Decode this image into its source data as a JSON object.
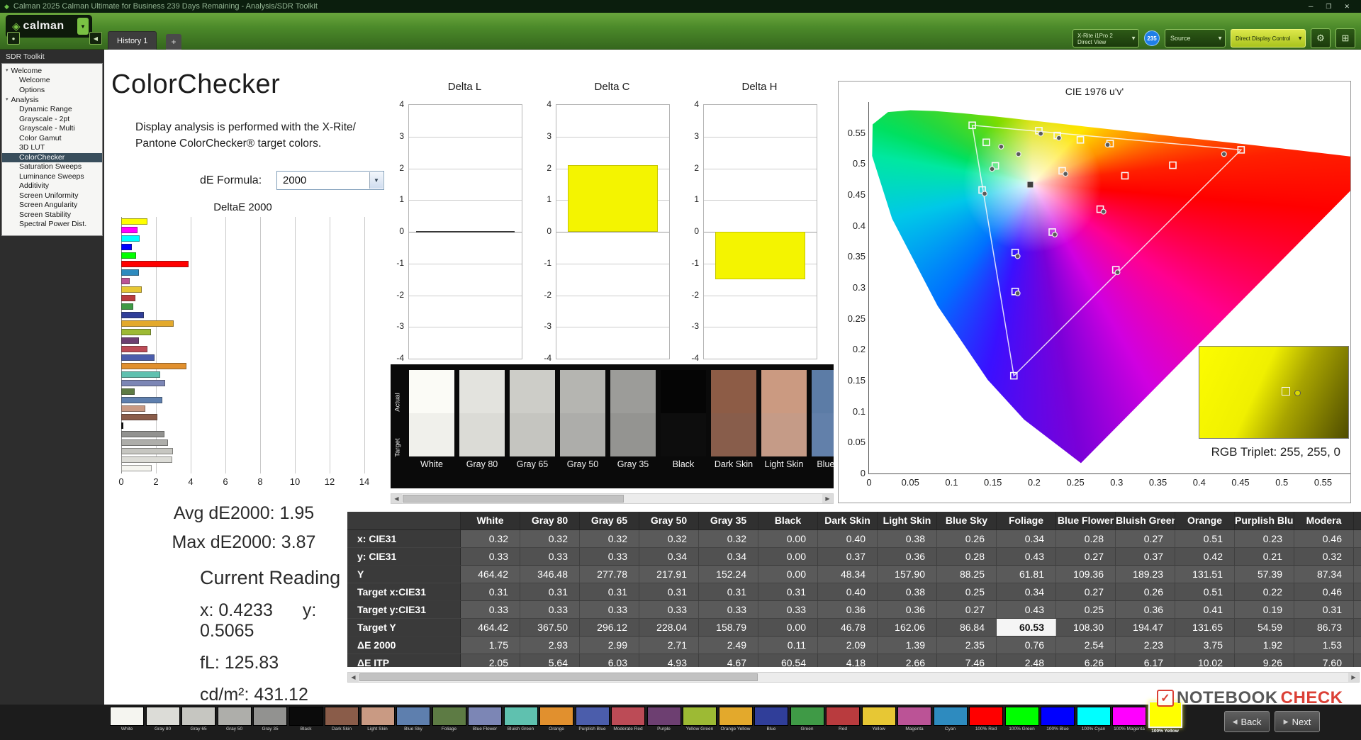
{
  "titlebar": {
    "title": "Calman 2025 Calman Ultimate for Business 239 Days Remaining  - Analysis/SDR Toolkit"
  },
  "toolbar": {
    "logo_text": "calman",
    "meter_line1": "X-Rite i1Pro 2",
    "meter_line2": "Direct View",
    "badge": "235",
    "source_label": "Source",
    "display_label": "Direct Display Control"
  },
  "tabs": {
    "history": "History 1",
    "add": "+"
  },
  "sidebar": {
    "title": "SDR Toolkit",
    "groups": [
      {
        "label": "Welcome",
        "items": [
          {
            "label": "Welcome"
          },
          {
            "label": "Options"
          }
        ]
      },
      {
        "label": "Analysis",
        "items": [
          {
            "label": "Dynamic Range"
          },
          {
            "label": "Grayscale - 2pt"
          },
          {
            "label": "Grayscale - Multi"
          },
          {
            "label": "Color Gamut"
          },
          {
            "label": "3D LUT"
          },
          {
            "label": "ColorChecker",
            "selected": true
          },
          {
            "label": "Saturation Sweeps"
          },
          {
            "label": "Luminance Sweeps"
          },
          {
            "label": "Additivity"
          },
          {
            "label": "Screen Uniformity"
          },
          {
            "label": "Screen Angularity"
          },
          {
            "label": "Screen Stability"
          },
          {
            "label": "Spectral Power Dist."
          }
        ]
      }
    ]
  },
  "page": {
    "title": "ColorChecker",
    "description_line1": "Display analysis is performed with the X-Rite/",
    "description_line2": "Pantone ColorChecker® target colors.",
    "formula_label": "dE Formula:",
    "formula_value": "2000"
  },
  "chart_data": [
    {
      "type": "bar",
      "orientation": "horizontal",
      "title": "DeltaE 2000",
      "xlim": [
        0,
        14
      ],
      "xticks": [
        0,
        2,
        4,
        6,
        8,
        10,
        12,
        14
      ],
      "categories": [
        "100% Yellow",
        "100% Magenta",
        "100% Cyan",
        "100% Blue",
        "100% Green",
        "100% Red",
        "Cyan",
        "Magenta",
        "Yellow",
        "Red",
        "Green",
        "Blue",
        "Orange Yellow",
        "Yellow Green",
        "Purple",
        "Moderate Red",
        "Purplish Blue",
        "Orange",
        "Bluish Green",
        "Blue Flower",
        "Foliage",
        "Blue Sky",
        "Light Skin",
        "Dark Skin",
        "Black",
        "Gray 35",
        "Gray 50",
        "Gray 65",
        "Gray 80",
        "White"
      ],
      "values": [
        1.5,
        0.95,
        1.05,
        0.6,
        0.85,
        3.87,
        1.0,
        0.5,
        1.2,
        0.8,
        0.7,
        1.3,
        3.0,
        1.7,
        1.0,
        1.53,
        1.92,
        3.75,
        2.23,
        2.54,
        0.76,
        2.35,
        1.39,
        2.09,
        0.11,
        2.49,
        2.71,
        2.99,
        2.93,
        1.75
      ],
      "colors": [
        "#ffff00",
        "#ff00ff",
        "#00ffff",
        "#0000ff",
        "#00ff00",
        "#ff0000",
        "#2e8bbf",
        "#bb5396",
        "#e7c734",
        "#b93b3e",
        "#3f9a46",
        "#303e99",
        "#e3a92c",
        "#9dba34",
        "#6d3f71",
        "#bc4b56",
        "#4b5dab",
        "#e1902e",
        "#5fc1af",
        "#7c86b5",
        "#5d7b44",
        "#5e7fae",
        "#c99a83",
        "#8a5c49",
        "#0b0b0b",
        "#929290",
        "#aeaeaa",
        "#c6c6c1",
        "#dcdcd7",
        "#f5f5f0"
      ]
    },
    {
      "type": "bar",
      "title": "Delta L",
      "ylim": [
        -4,
        4
      ],
      "yticks": [
        4,
        3,
        2,
        1,
        0,
        -1,
        -2,
        -3,
        -4
      ],
      "values": [
        0
      ],
      "bar_color": "#f4f400"
    },
    {
      "type": "bar",
      "title": "Delta C",
      "ylim": [
        -4,
        4
      ],
      "yticks": [
        4,
        3,
        2,
        1,
        0,
        -1,
        -2,
        -3,
        -4
      ],
      "values": [
        2.1
      ],
      "bar_color": "#f4f400"
    },
    {
      "type": "bar",
      "title": "Delta H",
      "ylim": [
        -4,
        4
      ],
      "yticks": [
        4,
        3,
        2,
        1,
        0,
        -1,
        -2,
        -3,
        -4
      ],
      "values": [
        -1.5
      ],
      "bar_color": "#f4f400"
    },
    {
      "type": "scatter",
      "title": "CIE 1976 u'v'",
      "xlim": [
        0,
        0.62
      ],
      "ylim": [
        0,
        0.6
      ],
      "xticks": [
        0,
        0.05,
        0.1,
        0.15,
        0.2,
        0.25,
        0.3,
        0.35,
        0.4,
        0.45,
        0.5,
        0.55
      ],
      "yticks": [
        0.55,
        0.5,
        0.45,
        0.4,
        0.35,
        0.3,
        0.25,
        0.2,
        0.15,
        0.1,
        0.05,
        0
      ],
      "gamut_triangle": {
        "r": [
          0.4507,
          0.5229
        ],
        "g": [
          0.125,
          0.5625
        ],
        "b": [
          0.1754,
          0.1579
        ]
      },
      "white_point": [
        0.1953,
        0.4666
      ],
      "targets": [
        [
          0.125,
          0.5625
        ],
        [
          0.4507,
          0.5229
        ],
        [
          0.1754,
          0.1579
        ],
        [
          0.2057,
          0.5538
        ],
        [
          0.228,
          0.546
        ],
        [
          0.256,
          0.539
        ],
        [
          0.292,
          0.533
        ],
        [
          0.368,
          0.498
        ],
        [
          0.31,
          0.481
        ],
        [
          0.142,
          0.535
        ],
        [
          0.153,
          0.497
        ],
        [
          0.137,
          0.458
        ],
        [
          0.234,
          0.489
        ],
        [
          0.28,
          0.427
        ],
        [
          0.222,
          0.39
        ],
        [
          0.177,
          0.357
        ],
        [
          0.299,
          0.329
        ],
        [
          0.177,
          0.294
        ]
      ],
      "measurements": [
        [
          0.181,
          0.516
        ],
        [
          0.208,
          0.549
        ],
        [
          0.23,
          0.542
        ],
        [
          0.16,
          0.528
        ],
        [
          0.149,
          0.492
        ],
        [
          0.14,
          0.452
        ],
        [
          0.238,
          0.484
        ],
        [
          0.284,
          0.423
        ],
        [
          0.225,
          0.386
        ],
        [
          0.18,
          0.351
        ],
        [
          0.301,
          0.325
        ],
        [
          0.18,
          0.291
        ],
        [
          0.289,
          0.531
        ],
        [
          0.43,
          0.516
        ]
      ],
      "swatch_label": "RGB Triplet: 255, 255, 0"
    }
  ],
  "swatch_strip": {
    "row_labels": [
      "Actual",
      "Target"
    ],
    "swatches": [
      {
        "name": "White",
        "actual": "#fbfbf6",
        "target": "#f0f0eb"
      },
      {
        "name": "Gray 80",
        "actual": "#e3e3de",
        "target": "#dbdbd6"
      },
      {
        "name": "Gray 65",
        "actual": "#cdcdc8",
        "target": "#c5c5c0"
      },
      {
        "name": "Gray 50",
        "actual": "#b5b5b1",
        "target": "#adadaa"
      },
      {
        "name": "Gray 35",
        "actual": "#9c9c99",
        "target": "#949491"
      },
      {
        "name": "Black",
        "actual": "#050505",
        "target": "#0d0d0d"
      },
      {
        "name": "Dark Skin",
        "actual": "#8d5c46",
        "target": "#885d4b"
      },
      {
        "name": "Light Skin",
        "actual": "#cb9a81",
        "target": "#c59b87"
      },
      {
        "name": "Blue Sky",
        "actual": "#5c7ca6",
        "target": "#6280aa"
      }
    ]
  },
  "stats": {
    "avg": "Avg dE2000: 1.95",
    "max": "Max dE2000: 3.87",
    "current_heading": "Current Reading",
    "x": "x: 0.4233",
    "y": "y: 0.5065",
    "fl": "fL: 125.83",
    "cdm2": "cd/m²: 431.12"
  },
  "patch_table": {
    "columns": [
      "White",
      "Gray 80",
      "Gray 65",
      "Gray 50",
      "Gray 35",
      "Black",
      "Dark Skin",
      "Light Skin",
      "Blue Sky",
      "Foliage",
      "Blue Flower",
      "Bluish Green",
      "Orange",
      "Purplish Blue",
      "Modera"
    ],
    "rows": [
      {
        "label": "x: CIE31",
        "values": [
          "0.32",
          "0.32",
          "0.32",
          "0.32",
          "0.32",
          "0.00",
          "0.40",
          "0.38",
          "0.26",
          "0.34",
          "0.28",
          "0.27",
          "0.51",
          "0.23",
          "0.46"
        ]
      },
      {
        "label": "y: CIE31",
        "values": [
          "0.33",
          "0.33",
          "0.33",
          "0.34",
          "0.34",
          "0.00",
          "0.37",
          "0.36",
          "0.28",
          "0.43",
          "0.27",
          "0.37",
          "0.42",
          "0.21",
          "0.32"
        ]
      },
      {
        "label": "Y",
        "values": [
          "464.42",
          "346.48",
          "277.78",
          "217.91",
          "152.24",
          "0.00",
          "48.34",
          "157.90",
          "88.25",
          "61.81",
          "109.36",
          "189.23",
          "131.51",
          "57.39",
          "87.34"
        ]
      },
      {
        "label": "Target x:CIE31",
        "values": [
          "0.31",
          "0.31",
          "0.31",
          "0.31",
          "0.31",
          "0.31",
          "0.40",
          "0.38",
          "0.25",
          "0.34",
          "0.27",
          "0.26",
          "0.51",
          "0.22",
          "0.46"
        ]
      },
      {
        "label": "Target y:CIE31",
        "values": [
          "0.33",
          "0.33",
          "0.33",
          "0.33",
          "0.33",
          "0.33",
          "0.36",
          "0.36",
          "0.27",
          "0.43",
          "0.25",
          "0.36",
          "0.41",
          "0.19",
          "0.31"
        ]
      },
      {
        "label": "Target Y",
        "values": [
          "464.42",
          "367.50",
          "296.12",
          "228.04",
          "158.79",
          "0.00",
          "46.78",
          "162.06",
          "86.84",
          "60.53",
          "108.30",
          "194.47",
          "131.65",
          "54.59",
          "86.73"
        ],
        "highlight_index": 9
      },
      {
        "label": "ΔE 2000",
        "values": [
          "1.75",
          "2.93",
          "2.99",
          "2.71",
          "2.49",
          "0.11",
          "2.09",
          "1.39",
          "2.35",
          "0.76",
          "2.54",
          "2.23",
          "3.75",
          "1.92",
          "1.53"
        ]
      },
      {
        "label": "ΔE ITP",
        "values": [
          "2.05",
          "5.64",
          "6.03",
          "4.93",
          "4.67",
          "60.54",
          "4.18",
          "2.66",
          "7.46",
          "2.48",
          "6.26",
          "6.17",
          "10.02",
          "9.26",
          "7.60"
        ]
      }
    ]
  },
  "bottom_strip": {
    "back_label": "Back",
    "next_label": "Next",
    "patches": [
      {
        "name": "White",
        "color": "#f5f5f0"
      },
      {
        "name": "Gray 80",
        "color": "#dcdcd7"
      },
      {
        "name": "Gray 65",
        "color": "#c6c6c1"
      },
      {
        "name": "Gray 50",
        "color": "#aeaeaa"
      },
      {
        "name": "Gray 35",
        "color": "#929290"
      },
      {
        "name": "Black",
        "color": "#0b0b0b"
      },
      {
        "name": "Dark Skin",
        "color": "#8a5c49"
      },
      {
        "name": "Light Skin",
        "color": "#c99a83"
      },
      {
        "name": "Blue Sky",
        "color": "#5e7fae"
      },
      {
        "name": "Foliage",
        "color": "#5d7b44"
      },
      {
        "name": "Blue Flower",
        "color": "#7c86b5"
      },
      {
        "name": "Bluish Green",
        "color": "#5fc1af"
      },
      {
        "name": "Orange",
        "color": "#e1902e"
      },
      {
        "name": "Purplish Blue",
        "color": "#4b5dab"
      },
      {
        "name": "Moderate Red",
        "color": "#bc4b56"
      },
      {
        "name": "Purple",
        "color": "#6d3f71"
      },
      {
        "name": "Yellow Green",
        "color": "#9dba34"
      },
      {
        "name": "Orange Yellow",
        "color": "#e3a92c"
      },
      {
        "name": "Blue",
        "color": "#303e99"
      },
      {
        "name": "Green",
        "color": "#3f9a46"
      },
      {
        "name": "Red",
        "color": "#b93b3e"
      },
      {
        "name": "Yellow",
        "color": "#e7c734"
      },
      {
        "name": "Magenta",
        "color": "#bb5396"
      },
      {
        "name": "Cyan",
        "color": "#2e8bbf"
      },
      {
        "name": "100% Red",
        "color": "#ff0000"
      },
      {
        "name": "100% Green",
        "color": "#00ff00"
      },
      {
        "name": "100% Blue",
        "color": "#0000ff"
      },
      {
        "name": "100% Cyan",
        "color": "#00ffff"
      },
      {
        "name": "100% Magenta",
        "color": "#ff00ff"
      },
      {
        "name": "100% Yellow",
        "color": "#ffff00",
        "selected": true
      }
    ]
  },
  "watermark": {
    "part1": "NOTEBOOK",
    "part2": "CHECK"
  }
}
